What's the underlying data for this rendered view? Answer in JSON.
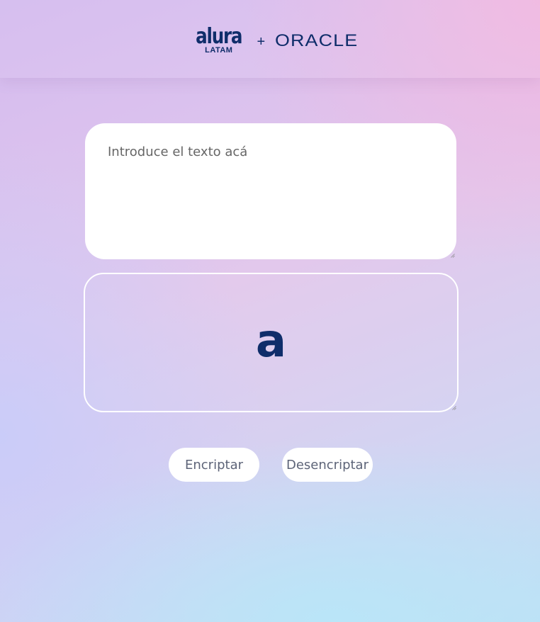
{
  "header": {
    "logo": {
      "alura": "alura",
      "latam": "LATAM",
      "plus": "+",
      "oracle": "ORACLE"
    }
  },
  "main": {
    "input": {
      "placeholder": "Introduce el texto acá",
      "value": ""
    },
    "output": {
      "glyph": "a"
    },
    "buttons": {
      "encrypt_label": "Encriptar",
      "decrypt_label": "Desencriptar"
    }
  },
  "colors": {
    "brand_navy": "#0f2d6a",
    "button_text": "#5d6478",
    "card_white": "#ffffff"
  }
}
